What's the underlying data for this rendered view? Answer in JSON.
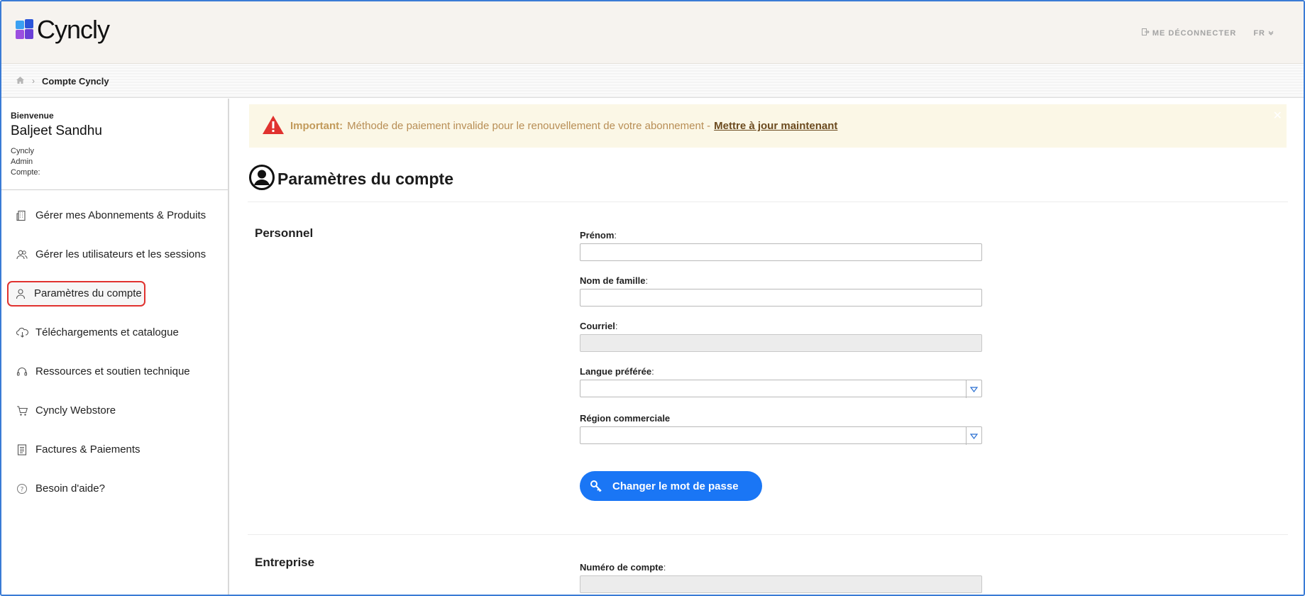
{
  "brand": {
    "name": "Cyncly"
  },
  "header": {
    "logout_label": "ME DÉCONNECTER",
    "language_label": "FR"
  },
  "breadcrumb": {
    "current": "Compte Cyncly"
  },
  "sidebar": {
    "welcome_label": "Bienvenue",
    "user_name": "Baljeet Sandhu",
    "org_line1": "Cyncly",
    "org_line2": "Admin",
    "org_line3": "Compte:",
    "items": [
      {
        "label": "Gérer mes Abonnements & Produits",
        "icon": "building-icon"
      },
      {
        "label": "Gérer les utilisateurs et les sessions",
        "icon": "users-icon"
      },
      {
        "label": "Paramètres du compte",
        "icon": "user-icon",
        "active": true
      },
      {
        "label": "Téléchargements et catalogue",
        "icon": "cloud-download-icon"
      },
      {
        "label": "Ressources et soutien technique",
        "icon": "headset-icon"
      },
      {
        "label": "Cyncly Webstore",
        "icon": "cart-icon"
      },
      {
        "label": "Factures & Paiements",
        "icon": "invoice-icon"
      },
      {
        "label": "Besoin d'aide?",
        "icon": "help-icon"
      }
    ]
  },
  "alert": {
    "prefix": "Important:",
    "message": "Méthode de paiement invalide pour le renouvellement de votre abonnement -",
    "link": "Mettre à jour maintenant"
  },
  "page": {
    "title": "Paramètres du compte",
    "personal_section": "Personnel",
    "company_section": "Entreprise",
    "fields": {
      "first_name": {
        "label": "Prénom",
        "colon": ":",
        "value": ""
      },
      "last_name": {
        "label": "Nom de famille",
        "colon": ":",
        "value": ""
      },
      "email": {
        "label": "Courriel",
        "colon": ":",
        "value": ""
      },
      "language": {
        "label": "Langue préférée",
        "colon": ":",
        "value": ""
      },
      "region": {
        "label": "Région commerciale",
        "value": ""
      },
      "account_number": {
        "label": "Numéro de compte",
        "colon": ":",
        "value": ""
      }
    },
    "change_password_label": "Changer le mot de passe"
  },
  "colors": {
    "accent": "#1a76f5",
    "alert_bg": "#fbf7e6",
    "warning": "#e0322f",
    "header_bg": "#f6f3ef"
  }
}
